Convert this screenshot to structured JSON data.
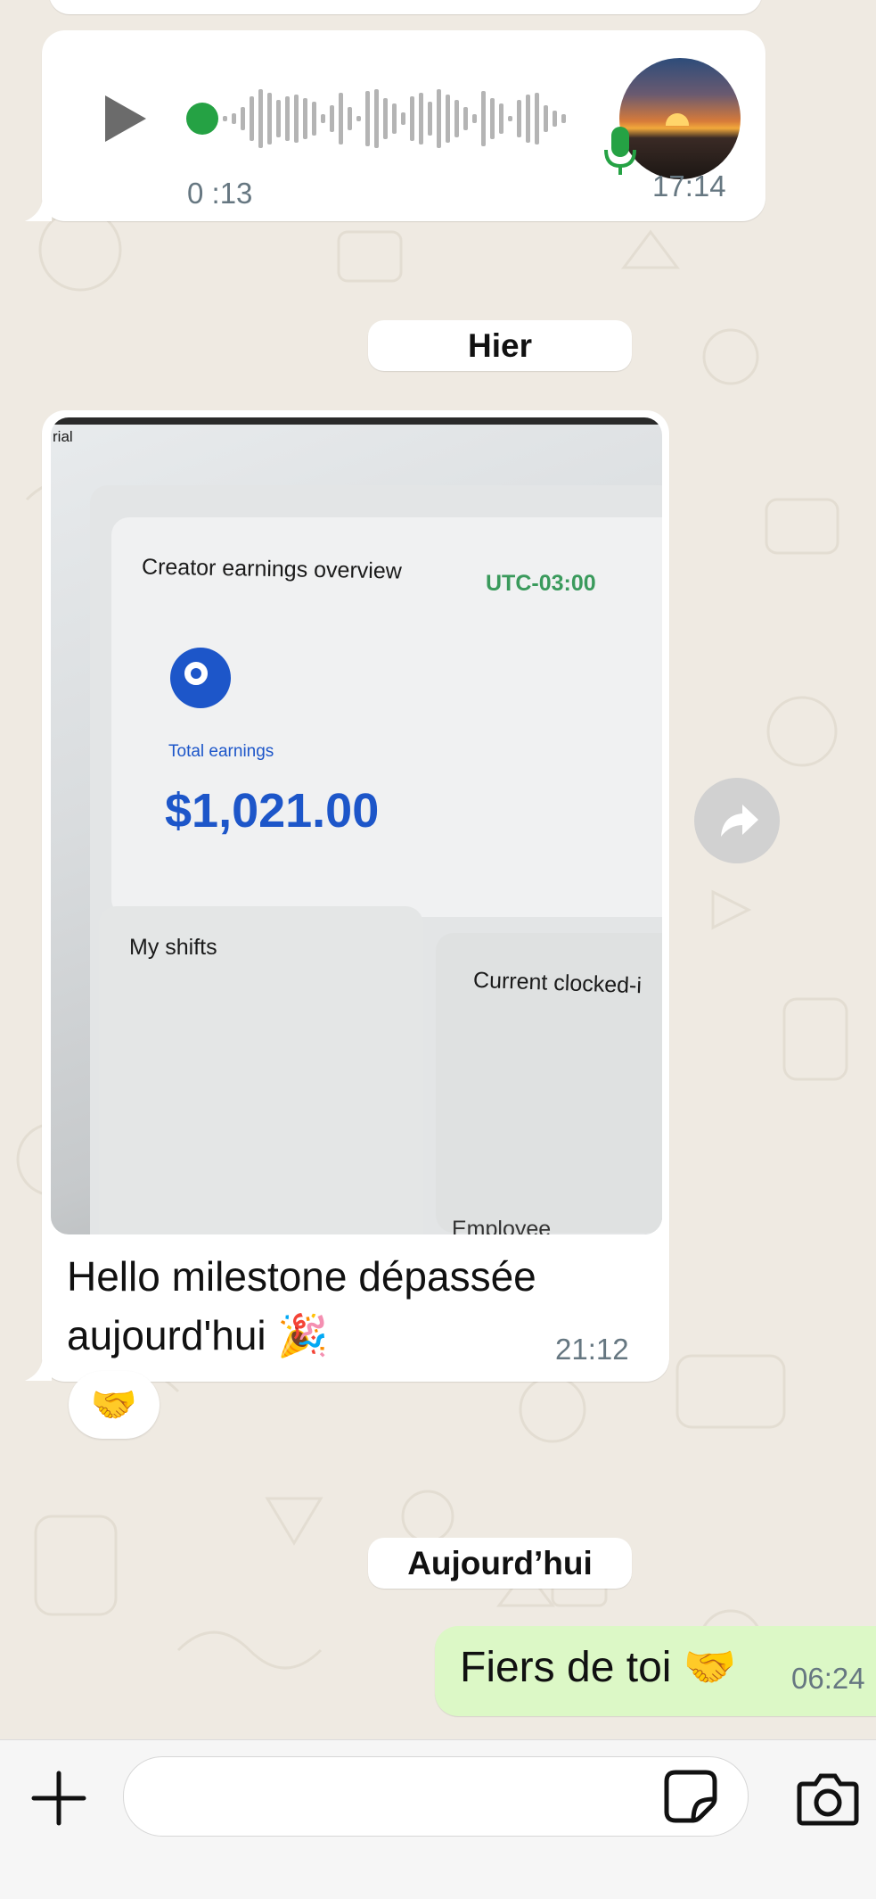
{
  "voice_message": {
    "duration": "0 :13",
    "time": "17:14",
    "play_icon": "play-icon",
    "mic_icon": "microphone-icon",
    "accent": "#25a244"
  },
  "separators": {
    "yesterday": "Hier",
    "today": "Aujourd’hui"
  },
  "photo_message": {
    "image_text": {
      "corner": "rial",
      "title": "Creator earnings overview",
      "timezone": "UTC-03:00",
      "total_label": "Total earnings",
      "total_value": "$1,021.00",
      "shifts": "My shifts",
      "clocked": "Current clocked-i",
      "employees": "Employee"
    },
    "caption_line1": "Hello milestone dépassée",
    "caption_line2": "aujourd'hui 🎉",
    "time": "21:12",
    "reaction": "🤝",
    "forward_icon": "forward-icon"
  },
  "outgoing_message": {
    "text": "Fiers de toi 🤝",
    "time": "06:24",
    "bubble_color": "#dcf8c6"
  },
  "composer": {
    "plus_icon": "plus-icon",
    "sticker_icon": "sticker-icon",
    "camera_icon": "camera-icon",
    "input_value": ""
  }
}
